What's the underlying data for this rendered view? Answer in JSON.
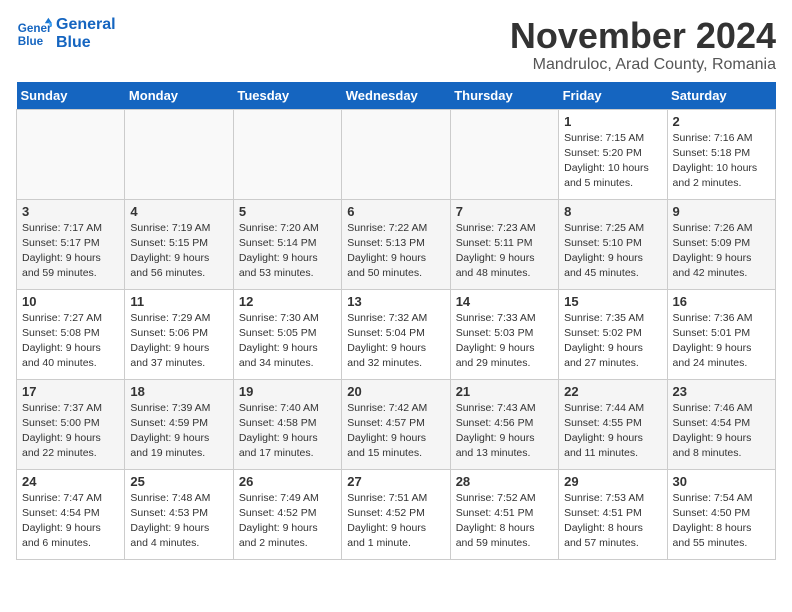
{
  "logo": {
    "line1": "General",
    "line2": "Blue"
  },
  "title": "November 2024",
  "location": "Mandruloc, Arad County, Romania",
  "days_of_week": [
    "Sunday",
    "Monday",
    "Tuesday",
    "Wednesday",
    "Thursday",
    "Friday",
    "Saturday"
  ],
  "weeks": [
    [
      {
        "day": null,
        "info": null
      },
      {
        "day": null,
        "info": null
      },
      {
        "day": null,
        "info": null
      },
      {
        "day": null,
        "info": null
      },
      {
        "day": null,
        "info": null
      },
      {
        "day": "1",
        "info": "Sunrise: 7:15 AM\nSunset: 5:20 PM\nDaylight: 10 hours\nand 5 minutes."
      },
      {
        "day": "2",
        "info": "Sunrise: 7:16 AM\nSunset: 5:18 PM\nDaylight: 10 hours\nand 2 minutes."
      }
    ],
    [
      {
        "day": "3",
        "info": "Sunrise: 7:17 AM\nSunset: 5:17 PM\nDaylight: 9 hours\nand 59 minutes."
      },
      {
        "day": "4",
        "info": "Sunrise: 7:19 AM\nSunset: 5:15 PM\nDaylight: 9 hours\nand 56 minutes."
      },
      {
        "day": "5",
        "info": "Sunrise: 7:20 AM\nSunset: 5:14 PM\nDaylight: 9 hours\nand 53 minutes."
      },
      {
        "day": "6",
        "info": "Sunrise: 7:22 AM\nSunset: 5:13 PM\nDaylight: 9 hours\nand 50 minutes."
      },
      {
        "day": "7",
        "info": "Sunrise: 7:23 AM\nSunset: 5:11 PM\nDaylight: 9 hours\nand 48 minutes."
      },
      {
        "day": "8",
        "info": "Sunrise: 7:25 AM\nSunset: 5:10 PM\nDaylight: 9 hours\nand 45 minutes."
      },
      {
        "day": "9",
        "info": "Sunrise: 7:26 AM\nSunset: 5:09 PM\nDaylight: 9 hours\nand 42 minutes."
      }
    ],
    [
      {
        "day": "10",
        "info": "Sunrise: 7:27 AM\nSunset: 5:08 PM\nDaylight: 9 hours\nand 40 minutes."
      },
      {
        "day": "11",
        "info": "Sunrise: 7:29 AM\nSunset: 5:06 PM\nDaylight: 9 hours\nand 37 minutes."
      },
      {
        "day": "12",
        "info": "Sunrise: 7:30 AM\nSunset: 5:05 PM\nDaylight: 9 hours\nand 34 minutes."
      },
      {
        "day": "13",
        "info": "Sunrise: 7:32 AM\nSunset: 5:04 PM\nDaylight: 9 hours\nand 32 minutes."
      },
      {
        "day": "14",
        "info": "Sunrise: 7:33 AM\nSunset: 5:03 PM\nDaylight: 9 hours\nand 29 minutes."
      },
      {
        "day": "15",
        "info": "Sunrise: 7:35 AM\nSunset: 5:02 PM\nDaylight: 9 hours\nand 27 minutes."
      },
      {
        "day": "16",
        "info": "Sunrise: 7:36 AM\nSunset: 5:01 PM\nDaylight: 9 hours\nand 24 minutes."
      }
    ],
    [
      {
        "day": "17",
        "info": "Sunrise: 7:37 AM\nSunset: 5:00 PM\nDaylight: 9 hours\nand 22 minutes."
      },
      {
        "day": "18",
        "info": "Sunrise: 7:39 AM\nSunset: 4:59 PM\nDaylight: 9 hours\nand 19 minutes."
      },
      {
        "day": "19",
        "info": "Sunrise: 7:40 AM\nSunset: 4:58 PM\nDaylight: 9 hours\nand 17 minutes."
      },
      {
        "day": "20",
        "info": "Sunrise: 7:42 AM\nSunset: 4:57 PM\nDaylight: 9 hours\nand 15 minutes."
      },
      {
        "day": "21",
        "info": "Sunrise: 7:43 AM\nSunset: 4:56 PM\nDaylight: 9 hours\nand 13 minutes."
      },
      {
        "day": "22",
        "info": "Sunrise: 7:44 AM\nSunset: 4:55 PM\nDaylight: 9 hours\nand 11 minutes."
      },
      {
        "day": "23",
        "info": "Sunrise: 7:46 AM\nSunset: 4:54 PM\nDaylight: 9 hours\nand 8 minutes."
      }
    ],
    [
      {
        "day": "24",
        "info": "Sunrise: 7:47 AM\nSunset: 4:54 PM\nDaylight: 9 hours\nand 6 minutes."
      },
      {
        "day": "25",
        "info": "Sunrise: 7:48 AM\nSunset: 4:53 PM\nDaylight: 9 hours\nand 4 minutes."
      },
      {
        "day": "26",
        "info": "Sunrise: 7:49 AM\nSunset: 4:52 PM\nDaylight: 9 hours\nand 2 minutes."
      },
      {
        "day": "27",
        "info": "Sunrise: 7:51 AM\nSunset: 4:52 PM\nDaylight: 9 hours\nand 1 minute."
      },
      {
        "day": "28",
        "info": "Sunrise: 7:52 AM\nSunset: 4:51 PM\nDaylight: 8 hours\nand 59 minutes."
      },
      {
        "day": "29",
        "info": "Sunrise: 7:53 AM\nSunset: 4:51 PM\nDaylight: 8 hours\nand 57 minutes."
      },
      {
        "day": "30",
        "info": "Sunrise: 7:54 AM\nSunset: 4:50 PM\nDaylight: 8 hours\nand 55 minutes."
      }
    ]
  ]
}
